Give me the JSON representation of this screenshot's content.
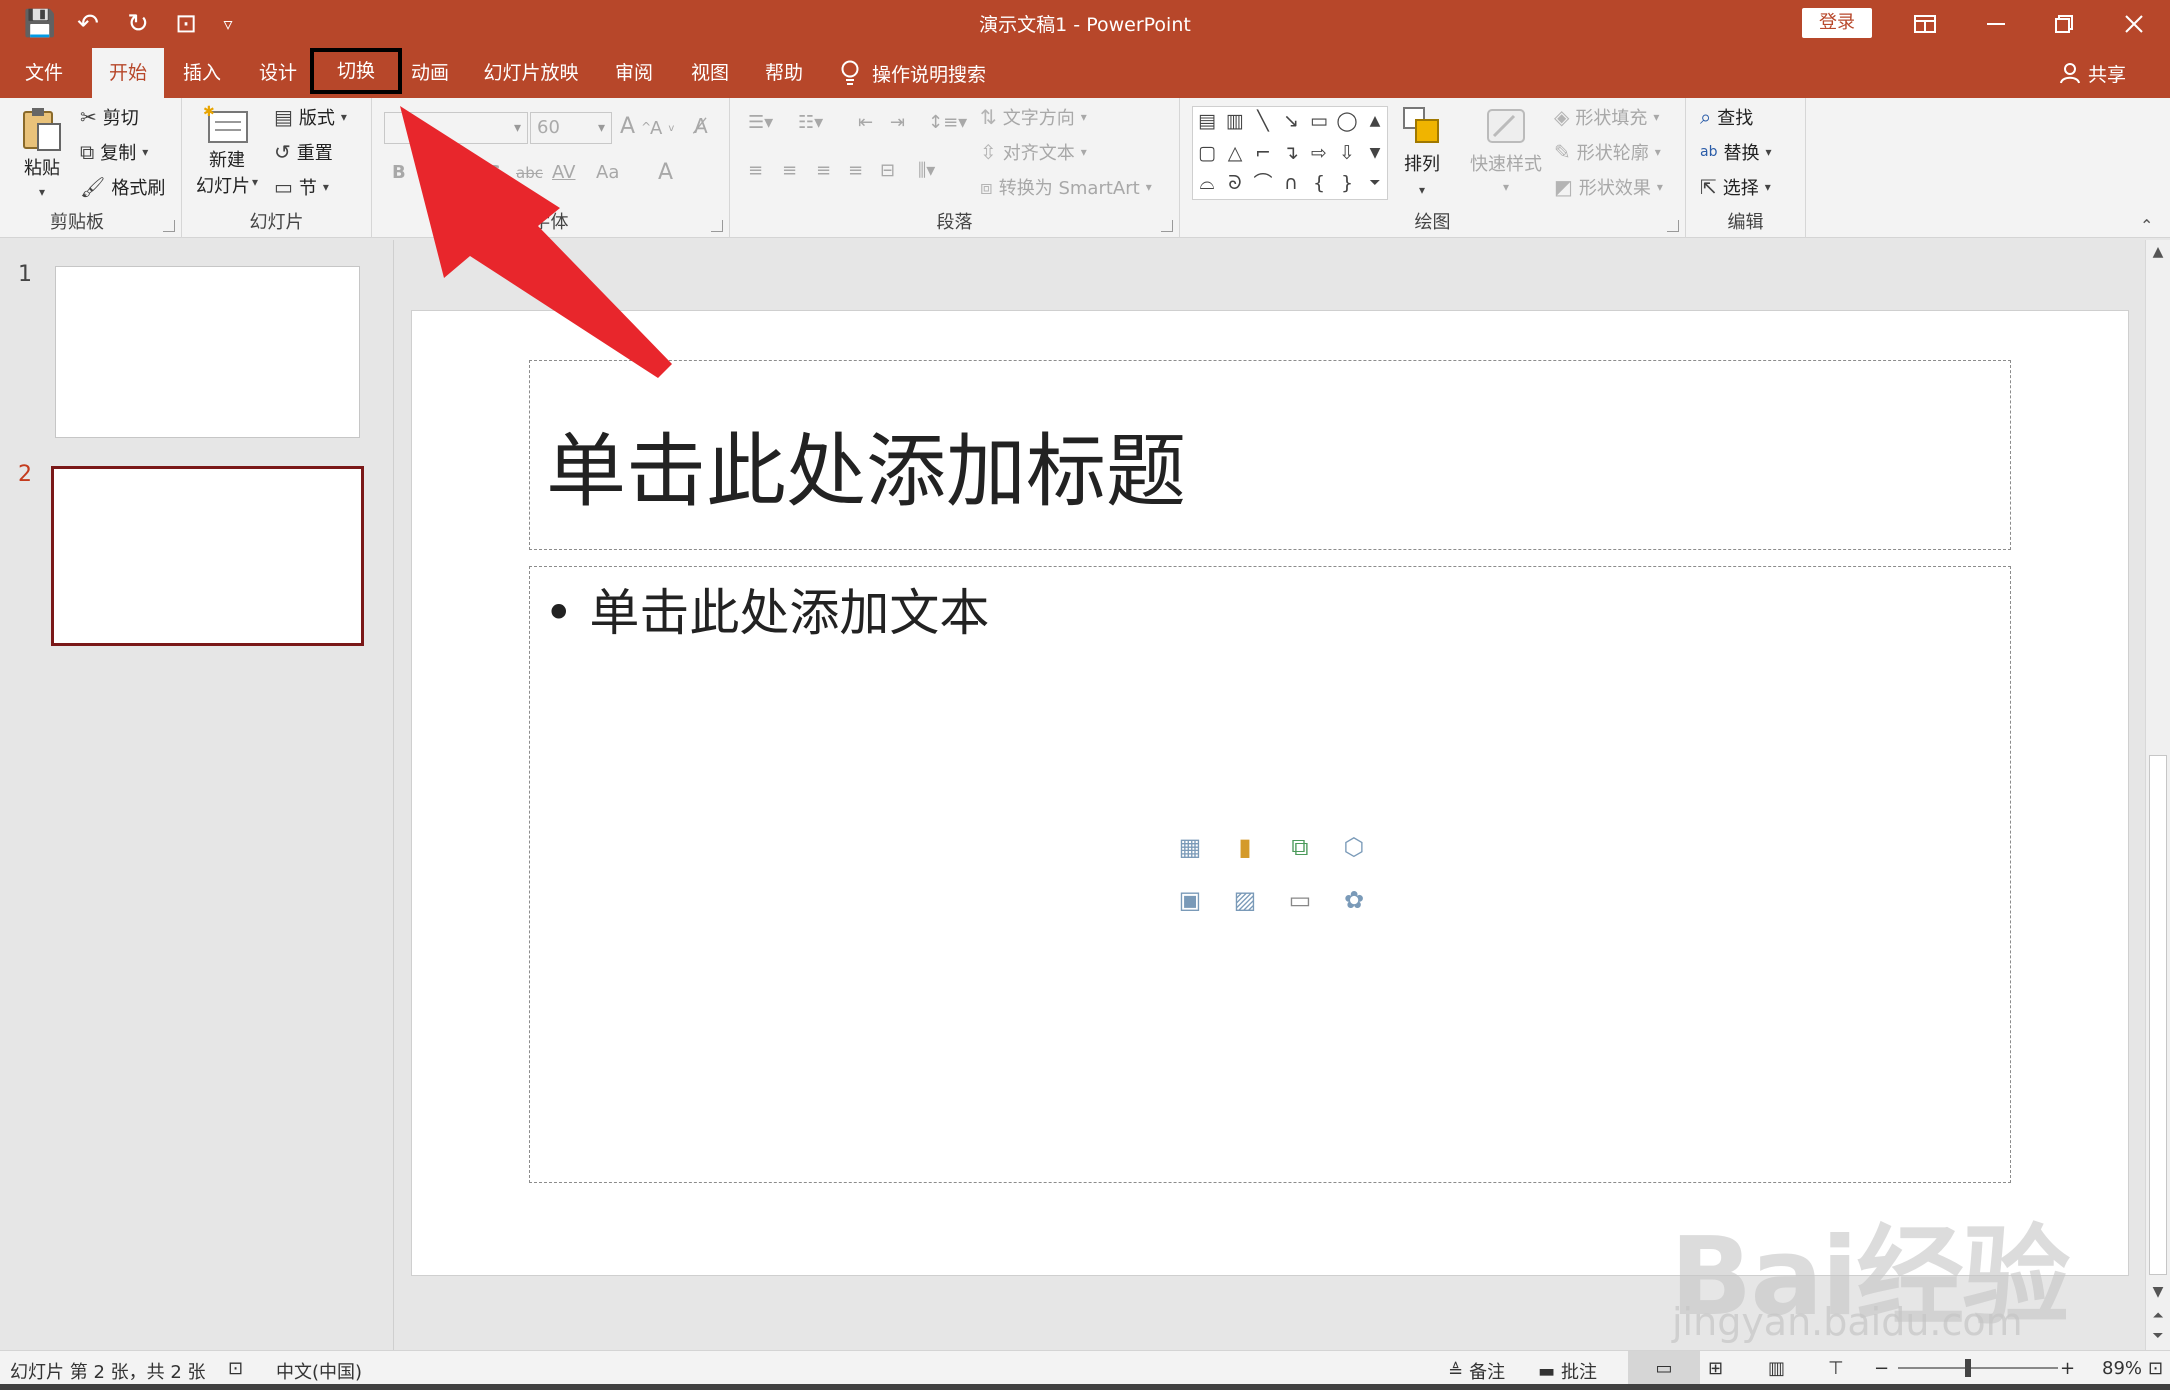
{
  "titlebar": {
    "title": "演示文稿1  -  PowerPoint",
    "login": "登录",
    "qat": {
      "save": "💾",
      "undo": "↶",
      "redo": "↻",
      "present": "⊡",
      "customize": "▿"
    }
  },
  "tabs": {
    "file": "文件",
    "home": "开始",
    "insert": "插入",
    "design": "设计",
    "transitions": "切换",
    "animations": "动画",
    "slideshow": "幻灯片放映",
    "review": "审阅",
    "view": "视图",
    "help": "帮助",
    "tell_me": "操作说明搜索",
    "share": "共享"
  },
  "ribbon": {
    "clipboard": {
      "paste": "粘贴",
      "cut": "剪切",
      "copy": "复制",
      "format_painter": "格式刷",
      "label": "剪贴板"
    },
    "slides": {
      "new_slide_1": "新建",
      "new_slide_2": "幻灯片",
      "layout": "版式",
      "reset": "重置",
      "section": "节",
      "label": "幻灯片"
    },
    "font": {
      "size": "60",
      "label": "字体",
      "bold": "B",
      "italic": "I",
      "underline": "U",
      "shadow": "S",
      "strike": "abc",
      "spacing": "AV",
      "case": "Aa",
      "color": "A"
    },
    "paragraph": {
      "text_direction": "文字方向",
      "align_text": "对齐文本",
      "smartart": "转换为 SmartArt",
      "label": "段落"
    },
    "drawing": {
      "arrange": "排列",
      "quick_styles": "快速样式",
      "shape_fill": "形状填充",
      "shape_outline": "形状轮廓",
      "shape_effects": "形状效果",
      "label": "绘图"
    },
    "editing": {
      "find": "查找",
      "replace": "替换",
      "select": "选择",
      "label": "编辑"
    }
  },
  "slides_pane": {
    "thumbs": [
      {
        "num": "1"
      },
      {
        "num": "2"
      }
    ],
    "selected": 2
  },
  "slide": {
    "title_placeholder": "单击此处添加标题",
    "body_placeholder": "• 单击此处添加文本"
  },
  "status": {
    "slide_info": "幻灯片 第 2 张，共 2 张",
    "language": "中文(中国)",
    "notes": "备注",
    "comments": "批注",
    "zoom": "89%",
    "zoom_level": 0.89
  },
  "watermark": {
    "line1": "Bai经验",
    "line2": "jingyan.baidu.com"
  },
  "colors": {
    "accent": "#b7472a",
    "selected_thumb": "#7a1818",
    "arrow": "#e8262c"
  }
}
